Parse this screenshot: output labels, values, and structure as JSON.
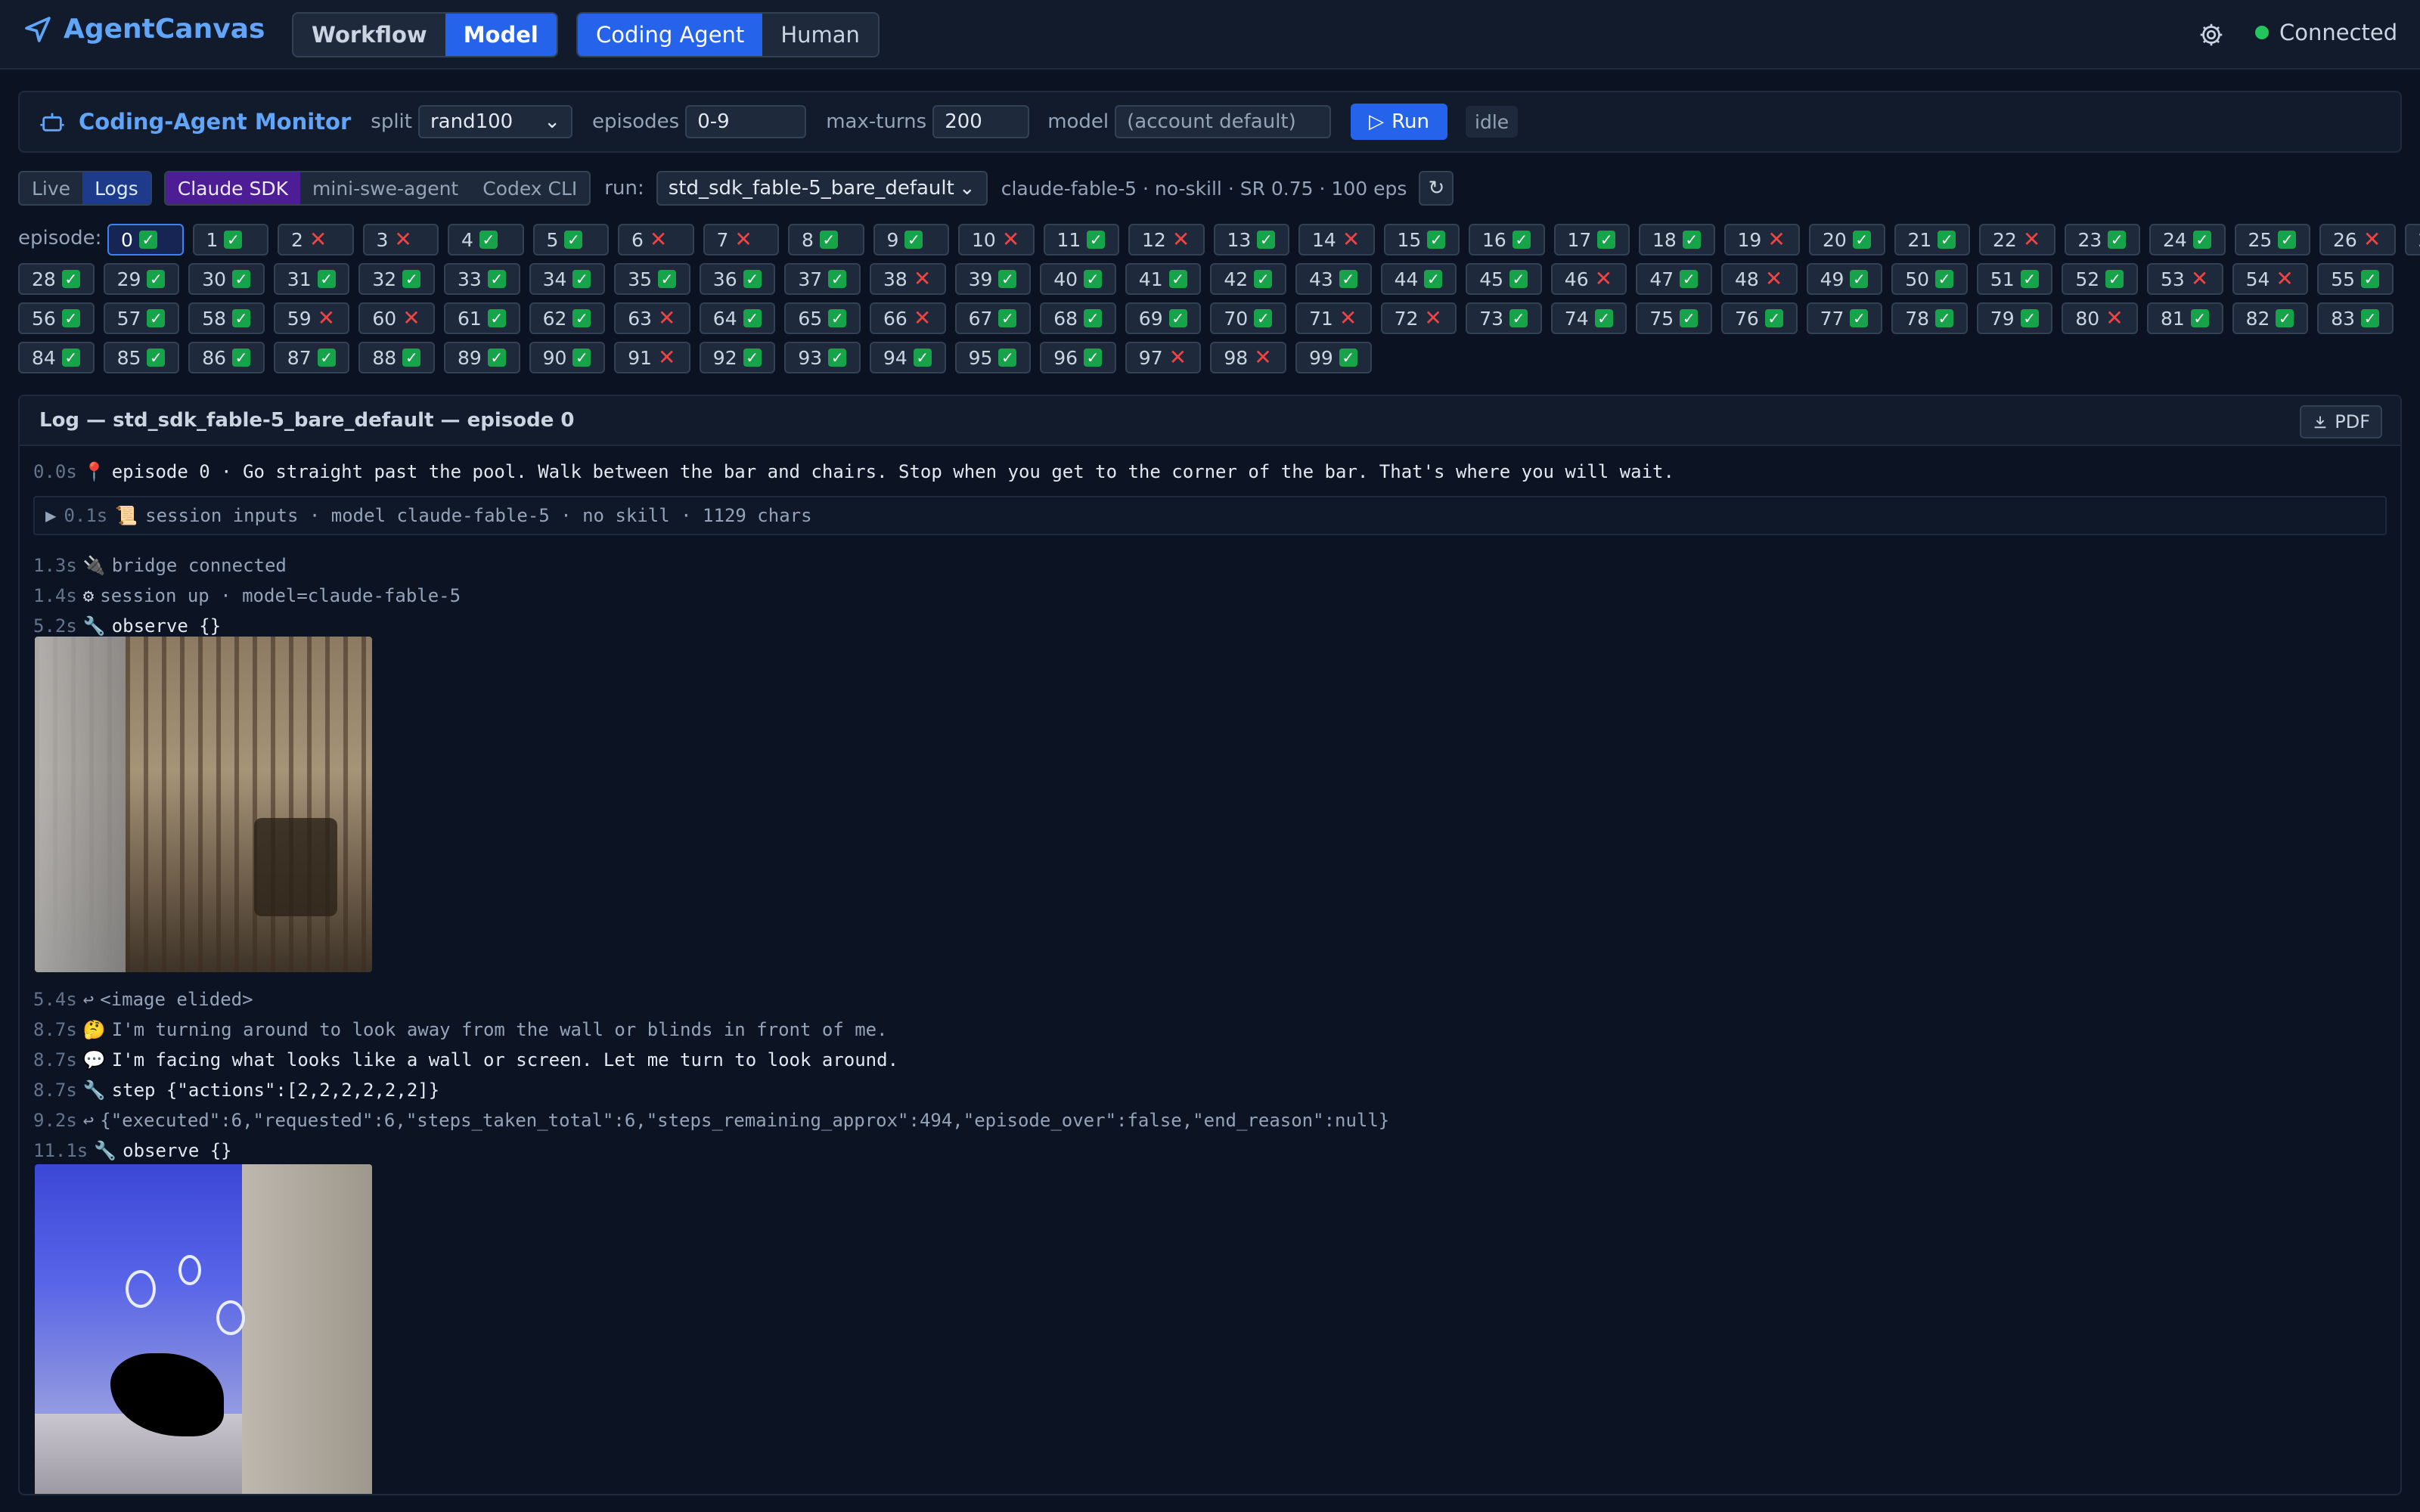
{
  "app": {
    "name": "AgentCanvas",
    "connection_status": "Connected",
    "status_color": "#22c55e",
    "accent": "#2563eb"
  },
  "nav": {
    "tabs": [
      "Workflow",
      "Model"
    ],
    "active": "Model"
  },
  "mode": {
    "tabs": [
      "Coding Agent",
      "Human"
    ],
    "active": "Coding Agent"
  },
  "monitor": {
    "title": "Coding-Agent Monitor",
    "split_label": "split",
    "split_value": "rand100",
    "episodes_label": "episodes",
    "episodes_value": "0-9",
    "max_turns_label": "max-turns",
    "max_turns_value": "200",
    "model_label": "model",
    "model_placeholder": "(account default)",
    "run_label": "Run",
    "status": "idle"
  },
  "run_bar": {
    "view_tabs": [
      "Live",
      "Logs"
    ],
    "view_active": "Logs",
    "agent_tabs": [
      "Claude SDK",
      "mini-swe-agent",
      "Codex CLI"
    ],
    "agent_active": "Claude SDK",
    "run_label": "run:",
    "run_value": "std_sdk_fable-5_bare_default",
    "run_info": "claude-fable-5 · no-skill · SR 0.75 · 100 eps",
    "refresh": "↻"
  },
  "episodes": {
    "label": "episode:",
    "selected": 0,
    "failed": [
      2,
      3,
      6,
      7,
      10,
      12,
      14,
      19,
      22,
      26,
      38,
      46,
      48,
      53,
      54,
      59,
      60,
      63,
      66,
      71,
      72,
      80,
      91,
      97,
      98
    ],
    "count": 100
  },
  "log": {
    "title": "Log — std_sdk_fable-5_bare_default — episode 0",
    "pdf_label": "PDF",
    "entries": [
      {
        "ts": "0.0s",
        "icon": "📍",
        "text": "episode 0 · Go straight past the pool. Walk between the bar and chairs.  Stop when you get to the corner of the bar.  That's where you will wait.",
        "style": "white"
      },
      {
        "ts": "0.1s",
        "icon": "📜",
        "text": "session inputs · model claude-fable-5 · no skill · 1129 chars",
        "style": "session"
      },
      {
        "ts": "1.3s",
        "icon": "🔌",
        "text": "bridge connected",
        "style": "dim"
      },
      {
        "ts": "1.4s",
        "icon": "⚙",
        "text": "session up · model=claude-fable-5",
        "style": "dim"
      },
      {
        "ts": "5.2s",
        "icon": "🔧",
        "text": "observe {}",
        "style": "white"
      },
      {
        "ts": "5.4s",
        "icon": "↩",
        "text": "<image elided>",
        "style": "dim"
      },
      {
        "ts": "8.7s",
        "icon": "🤔",
        "text": "I'm turning around to look away from the wall or blinds in front of me.",
        "style": "dim"
      },
      {
        "ts": "8.7s",
        "icon": "💬",
        "text": "I'm facing what looks like a wall or screen. Let me turn to look around.",
        "style": "white"
      },
      {
        "ts": "8.7s",
        "icon": "🔧",
        "text": "step {\"actions\":[2,2,2,2,2,2]}",
        "style": "white"
      },
      {
        "ts": "9.2s",
        "icon": "↩",
        "text": "{\"executed\":6,\"requested\":6,\"steps_taken_total\":6,\"steps_remaining_approx\":494,\"episode_over\":false,\"end_reason\":null}",
        "style": "dim"
      },
      {
        "ts": "11.1s",
        "icon": "🔧",
        "text": "observe {}",
        "style": "white"
      }
    ]
  }
}
